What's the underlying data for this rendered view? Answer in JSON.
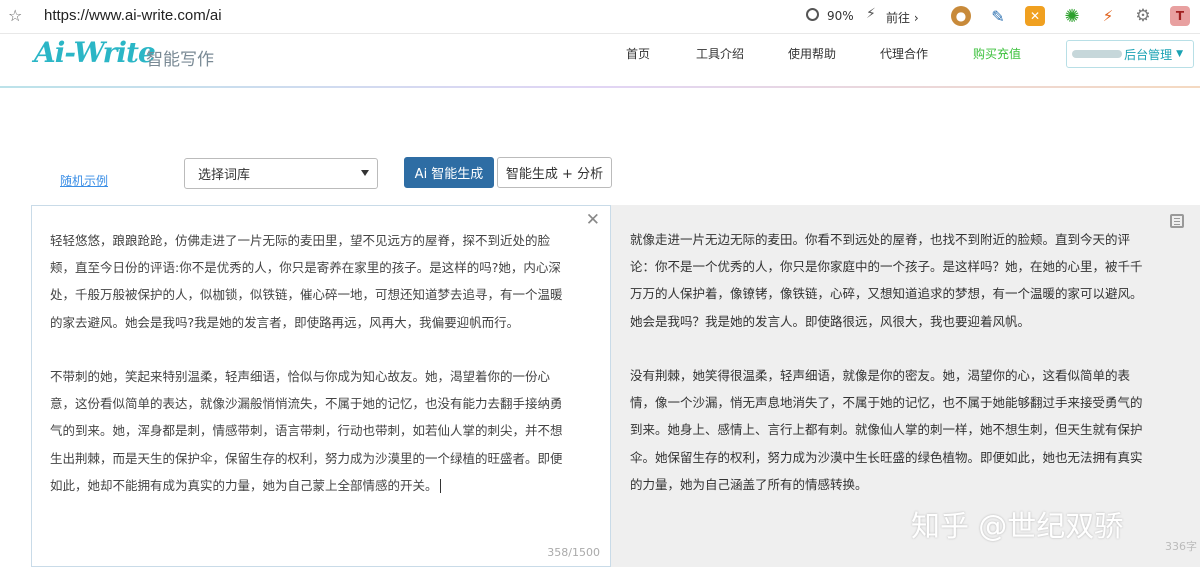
{
  "browser": {
    "url": "https://www.ai-write.com/ai",
    "zoom": "90%",
    "forward_label": "前往"
  },
  "header": {
    "logo": "Ai-Write",
    "logo_sub": "智能写作",
    "nav": [
      "首页",
      "工具介绍",
      "使用帮助",
      "代理合作",
      "购买充值"
    ],
    "admin_label": "后台管理"
  },
  "controls": {
    "random_link": "随机示例",
    "select_value": "选择词库",
    "generate_label": "Ai 智能生成",
    "generate_analyze_label": "智能生成 + 分析"
  },
  "left_panel": {
    "paragraphs": [
      "轻轻悠悠，踉踉跄跄，仿佛走进了一片无际的麦田里，望不见远方的屋脊，探不到近处的脸颊，直至今日份的评语:你不是优秀的人，你只是寄养在家里的孩子。是这样的吗?她，内心深处，千般万般被保护的人，似枷锁，似铁链，催心碎一地，可想还知道梦去追寻，有一个温暖的家去避风。她会是我吗?我是她的发言者，即使路再远，风再大，我偏要迎帆而行。",
      "不带刺的她，笑起来特别温柔，轻声细语，恰似与你成为知心故友。她，渴望着你的一份心意，这份看似简单的表达，就像沙漏般悄悄流失，不属于她的记忆，也没有能力去翻手接纳勇气的到来。她，浑身都是刺，情感带刺，语言带刺，行动也带刺，如若仙人掌的刺尖，并不想生出荆棘，而是天生的保护伞，保留生存的权利，努力成为沙漠里的一个绿植的旺盛者。即便如此，她却不能拥有成为真实的力量，她为自己蒙上全部情感的开关。"
    ],
    "counter": "358/1500"
  },
  "right_panel": {
    "paragraphs": [
      "就像走进一片无边无际的麦田。你看不到远处的屋脊，也找不到附近的脸颊。直到今天的评论：你不是一个优秀的人，你只是你家庭中的一个孩子。是这样吗？她，在她的心里，被千千万万的人保护着，像镣铐，像铁链，心碎，又想知道追求的梦想，有一个温暖的家可以避风。她会是我吗？我是她的发言人。即使路很远，风很大，我也要迎着风帆。",
      "没有荆棘，她笑得很温柔，轻声细语，就像是你的密友。她，渴望你的心，这看似简单的表情，像一个沙漏，悄无声息地消失了，不属于她的记忆，也不属于她能够翻过手来接受勇气的到来。她身上、感情上、言行上都有刺。就像仙人掌的刺一样，她不想生刺，但天生就有保护伞。她保留生存的权利，努力成为沙漠中生长旺盛的绿色植物。即便如此，她也无法拥有真实的力量，她为自己涵盖了所有的情感转换。"
    ],
    "counter": "336字",
    "watermark": "知乎 @世纪双骄"
  },
  "colors": {
    "brand": "#2bb6c6",
    "primary_button": "#2e6da4",
    "buy_link": "#3cc13c"
  }
}
